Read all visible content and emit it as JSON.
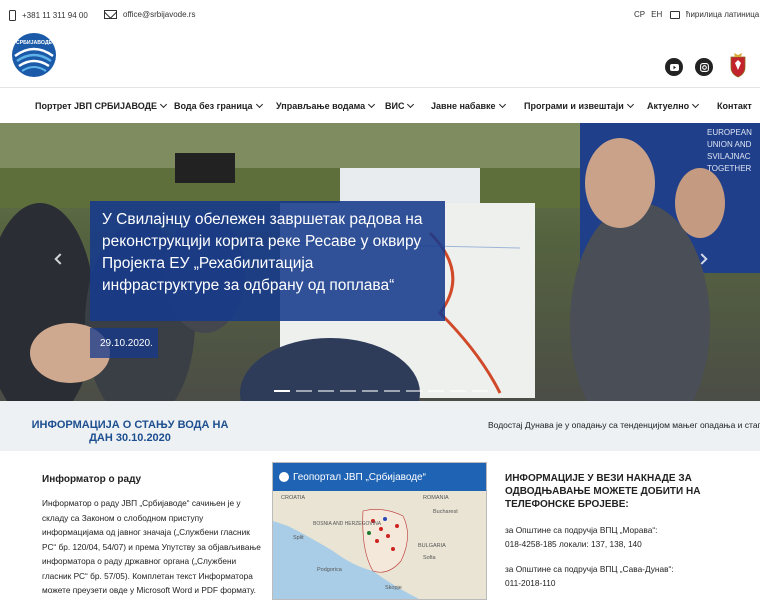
{
  "topbar": {
    "phone": "+381 11 311 94 00",
    "email": "office@srbijavode.rs",
    "lang_sr": "СР",
    "lang_en": "ЕН",
    "script_switch": "ћирилица латиница"
  },
  "header": {
    "logo_text": "СРБИЈАВОДЕ",
    "social": [
      "youtube-icon",
      "instagram-icon"
    ]
  },
  "nav": {
    "items": [
      {
        "label": "Портрет ЈВП СРБИЈАВОДЕ",
        "dropdown": true
      },
      {
        "label": "Вода без граница",
        "dropdown": true
      },
      {
        "label": "Управљање водама",
        "dropdown": true
      },
      {
        "label": "ВИС",
        "dropdown": true
      },
      {
        "label": "Јавне набавке",
        "dropdown": true
      },
      {
        "label": "Програми и извештаји",
        "dropdown": true
      },
      {
        "label": "Актуелно",
        "dropdown": true
      },
      {
        "label": "Контакт",
        "dropdown": false
      }
    ]
  },
  "hero": {
    "caption": "У Свилајнцу обележен завршетак радова на реконструкцији корита реке Ресаве у оквиру Пројекта ЕУ „Рехабилитација инфраструктуре за одбрану од поплава“",
    "date": "29.10.2020.",
    "slide_count": 10,
    "active_slide": 1
  },
  "water": {
    "title": "ИНФОРМАЦИЈА О СТАЊУ ВОДА НА ДАН 30.10.2020",
    "status": "Водостај Дунава је у опадању са тенденцијом мањег опадања и стаг"
  },
  "informator": {
    "title": "Информатор о раду",
    "body": "Информатор о раду ЈВП „Србијаводе“ сачињен је у складу са Законом о слободном приступу информацијама од јавног значаја („Службени гласник РС“ бр. 120/04, 54/07) и према Упутству за објављивање информатора о раду државног органа („Службени гласник РС“ бр. 57/05). Комплетан текст Информатора можете преузети овде у Microsoft Word и PDF формату."
  },
  "geoportal": {
    "title": "Геопортал ЈВП „Србијаводе“",
    "map_labels": [
      "CROATIA",
      "BOSNIA AND HERZEGOVINA",
      "Bucharest",
      "ROMANIA",
      "BULGARIA",
      "Sofia",
      "Skopje",
      "Podgorica",
      "Split"
    ]
  },
  "fees": {
    "title": "ИНФОРМАЦИЈЕ У ВЕЗИ НАКНАДЕ ЗА ОДВОДЊАВАЊЕ МОЖЕТЕ ДОБИТИ НА ТЕЛЕФОНСКЕ БРОЈЕВЕ:",
    "entries": [
      {
        "label": "за Општине са подручја ВПЦ „Морава“:",
        "numbers": "018-4258-185 локали: 137, 138, 140"
      },
      {
        "label": "за Општине са подручја ВПЦ „Сава-Дунав“:",
        "numbers": "011-2018-110"
      }
    ]
  },
  "colors": {
    "brand_blue": "#1d4e8f",
    "caption_bg": "#163a8c",
    "geoportal_blue": "#1f63b5"
  }
}
